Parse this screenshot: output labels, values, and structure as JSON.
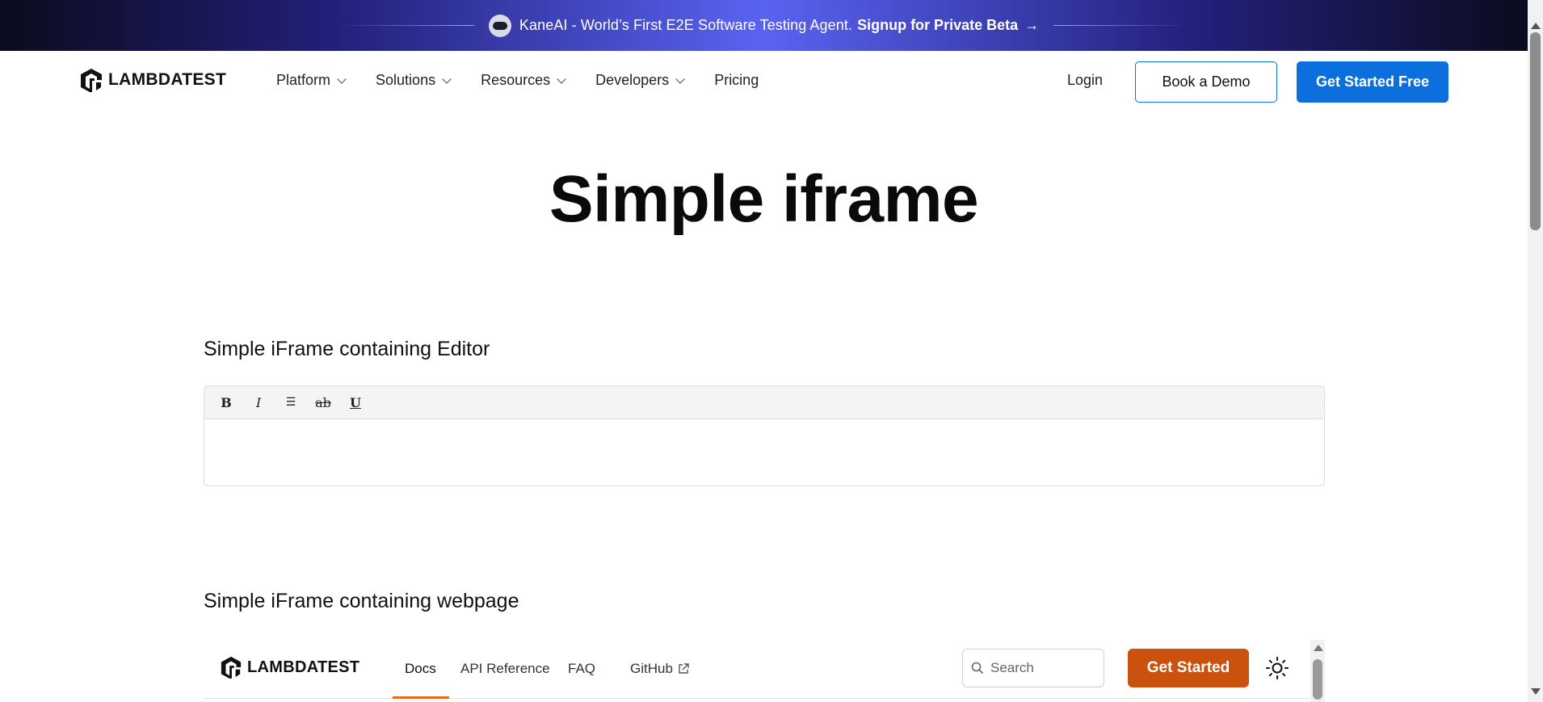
{
  "banner": {
    "message": "KaneAI - World’s First E2E Software Testing Agent.",
    "cta": "Signup for Private Beta",
    "arrow": "→",
    "icon": "robot-icon"
  },
  "nav": {
    "logo_text": "LAMBDATEST",
    "menu": [
      {
        "label": "Platform"
      },
      {
        "label": "Solutions"
      },
      {
        "label": "Resources"
      },
      {
        "label": "Developers"
      },
      {
        "label": "Pricing"
      }
    ],
    "login": "Login",
    "book_demo": "Book a Demo",
    "get_started": "Get Started Free"
  },
  "page": {
    "title": "Simple iframe",
    "section_editor": "Simple iFrame containing Editor",
    "section_webpage": "Simple iFrame containing webpage"
  },
  "editor": {
    "toolbar": {
      "bold": "B",
      "italic": "I",
      "list": "☰",
      "strike": "ab",
      "underline": "U"
    }
  },
  "embedded_page": {
    "logo_text": "LAMBDATEST",
    "links": {
      "docs": "Docs",
      "api": "API Reference",
      "faq": "FAQ",
      "github": "GitHub"
    },
    "search_placeholder": "Search",
    "get_started": "Get Started",
    "theme_icon": "sun-icon"
  },
  "colors": {
    "primary_blue": "#0b6fde",
    "orange_cta": "#c9520c",
    "docs_underline": "#e86a1f"
  }
}
